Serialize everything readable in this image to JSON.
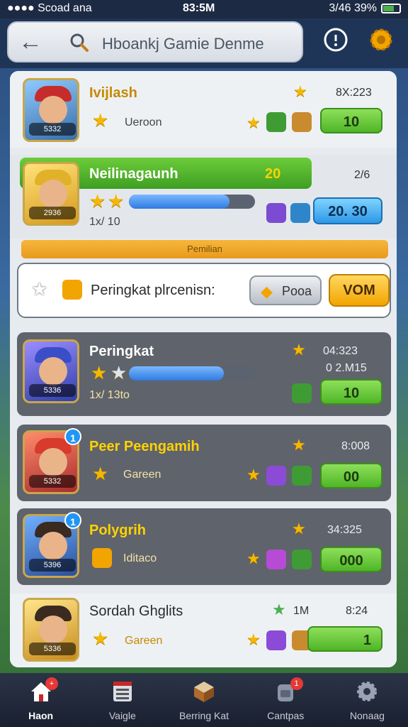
{
  "status_bar": {
    "carrier": "●●●● Scoad ana",
    "time": "83:5M",
    "right_text": "3/46 39%"
  },
  "header": {
    "search_text": "Hboankj Gamie Denme"
  },
  "rows": [
    {
      "title": "Ivijlash",
      "subtext": "Ueroon",
      "score": "8X:223",
      "button": "10",
      "level": "5332"
    },
    {
      "title": "Neilinagaunh",
      "coin_label": "20",
      "subtext": "1x/ 10",
      "score": "2/6",
      "button": "20. 30",
      "level": "2936",
      "progress": 0.8
    },
    {
      "title": "Peringkat",
      "subtext": "1x/ 13to",
      "score": "04:323",
      "score2": "0 2.M15",
      "button": "10",
      "level": "5336",
      "progress": 0.75
    },
    {
      "title": "Peer Peengamih",
      "subtext": "Gareen",
      "score": "8:008",
      "button": "00",
      "level": "5332",
      "badge": "1"
    },
    {
      "title": "Polygrih",
      "subtext": "Iditaco",
      "score": "34:325",
      "button": "000",
      "level": "5396",
      "badge": "1"
    },
    {
      "title": "Sordah Ghglits",
      "subtext": "Gareen",
      "score": "8:24",
      "mid": "1M",
      "button": "1",
      "level": "5336"
    }
  ],
  "banner": {
    "text": "Pemilian"
  },
  "callout": {
    "text": "Peringkat plrcenisn:",
    "secondary_button": "Pooa",
    "primary_button": "VOM"
  },
  "tabs": [
    {
      "label": "Haon",
      "icon": "home-icon",
      "badge": "+"
    },
    {
      "label": "Vaigle",
      "icon": "list-icon"
    },
    {
      "label": "Berring Kat",
      "icon": "chest-icon"
    },
    {
      "label": "Cantpas",
      "icon": "backpack-icon",
      "badge": "1"
    },
    {
      "label": "Nonaag",
      "icon": "gear-icon"
    }
  ]
}
